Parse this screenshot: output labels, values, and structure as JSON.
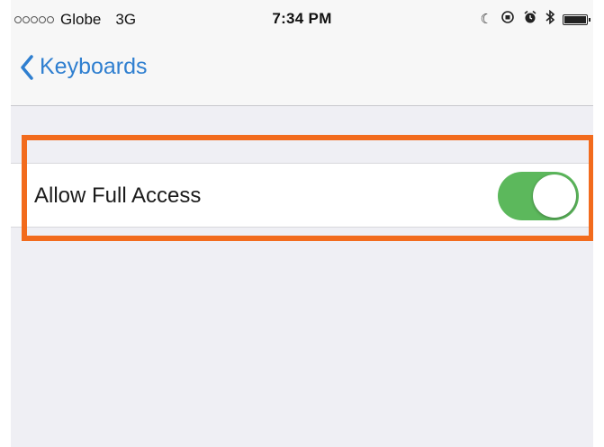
{
  "status_bar": {
    "carrier": "Globe",
    "network": "3G",
    "time": "7:34 PM",
    "icons": [
      "moon-icon",
      "orientation-lock-icon",
      "alarm-icon",
      "bluetooth-icon",
      "battery-icon"
    ]
  },
  "nav": {
    "back_label": "Keyboards"
  },
  "settings": {
    "full_access_label": "Allow Full Access",
    "full_access_enabled": true
  },
  "colors": {
    "accent": "#2f7fd0",
    "toggle_on": "#5cb85c",
    "highlight": "#f26b1d",
    "background": "#efeff4"
  }
}
